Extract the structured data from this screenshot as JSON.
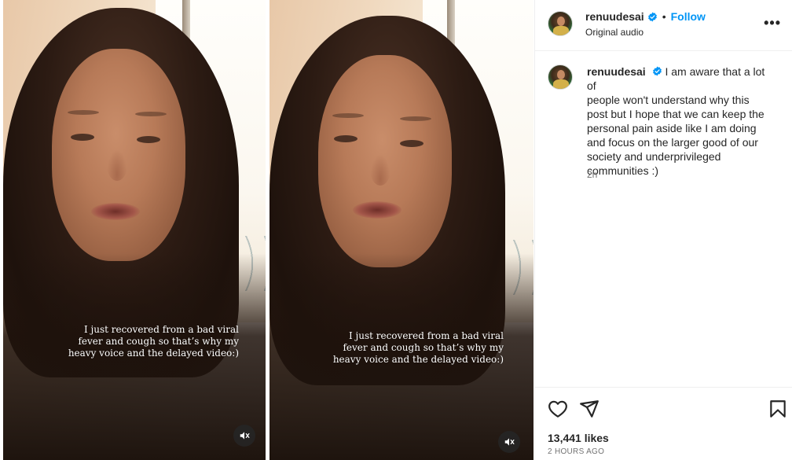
{
  "videos": [
    {
      "caption_lines": [
        "I just recovered from a bad viral",
        "fever and cough so that’s why my",
        "heavy voice and the delayed video:)"
      ],
      "mute_icon": "speaker-muted-icon"
    },
    {
      "caption_lines": [
        "I just recovered from a bad viral",
        "fever and cough so that’s why my",
        "heavy voice and the delayed video:)"
      ],
      "mute_icon": "speaker-muted-icon"
    }
  ],
  "post": {
    "username": "renuudesai",
    "verified": true,
    "separator": "•",
    "follow_label": "Follow",
    "audio_label": "Original audio",
    "more_label": "•••",
    "caption_lines": [
      "I am aware that a lot of",
      "people won't understand why this",
      "post but I hope that we can keep the",
      "personal pain aside like I am doing",
      "and focus on the larger good of our",
      "society and underprivileged",
      "communities :)"
    ],
    "caption_first_line_prefix": "I am aware that a lot of",
    "caption_time": "2h",
    "likes": "13,441 likes",
    "posted_ago": "2 HOURS AGO"
  },
  "colors": {
    "accent": "#0095f6",
    "verified": "#0095f6",
    "text": "#262626",
    "muted": "#737373"
  },
  "icons": [
    "heart-icon",
    "share-icon",
    "bookmark-icon",
    "more-icon",
    "verified-badge-icon",
    "speaker-muted-icon"
  ]
}
